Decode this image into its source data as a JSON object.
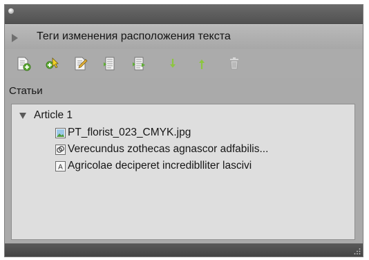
{
  "panel": {
    "tab_title": "Теги изменения расположения текста",
    "toolbar": {
      "buttons": [
        {
          "icon": "new-article-icon"
        },
        {
          "icon": "add-selected-icon"
        },
        {
          "icon": "edit-icon"
        },
        {
          "icon": "new-from-layout-icon"
        },
        {
          "icon": "new-from-selection-icon"
        },
        {
          "icon": "move-down-icon"
        },
        {
          "icon": "move-up-icon"
        },
        {
          "icon": "trash-icon"
        }
      ]
    },
    "section_label": "Статьи",
    "tree": {
      "article": {
        "label": "Article 1",
        "expanded": true
      },
      "items": [
        {
          "label": "PT_florist_023_CMYK.jpg",
          "icon": "image-icon"
        },
        {
          "label": "Verecundus zothecas agnascor adfabilis...",
          "icon": "linked-text-icon"
        },
        {
          "label": "Agricolae deciperet incrediblliter lascivi",
          "icon": "text-frame-icon"
        }
      ]
    }
  },
  "colors": {
    "panel_bg": "#aaaaaa",
    "list_bg": "#dedede",
    "titlebar": "#5c5c5c",
    "arrow_green": "#8cc63f"
  }
}
